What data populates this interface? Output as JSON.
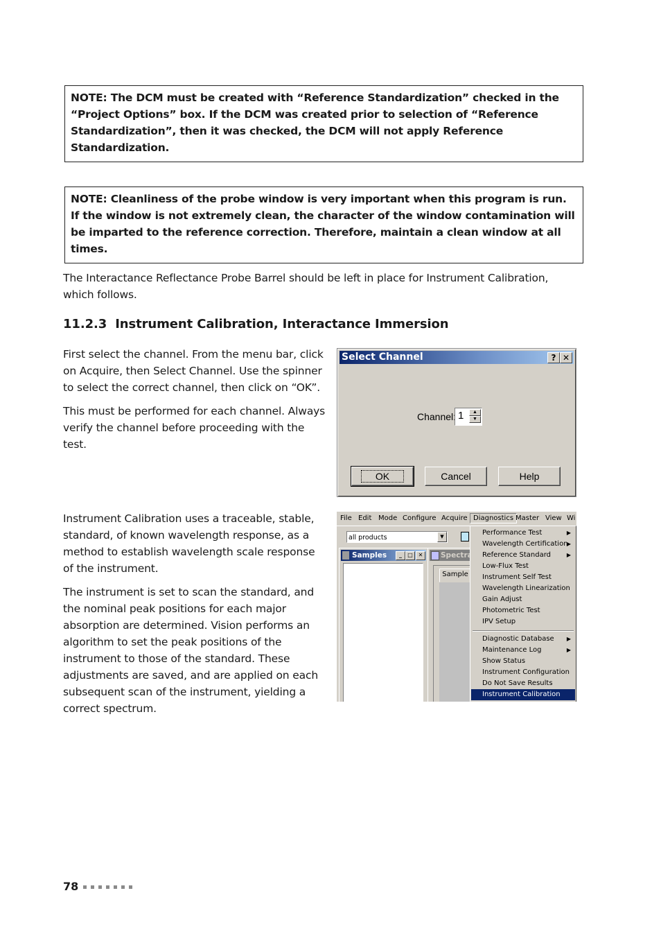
{
  "notes": [
    "NOTE: The DCM must be created with “Reference Standardization” checked in the “Project Options” box. If the DCM was created prior to selection of “Reference Standardization”, then it was checked, the DCM will not apply Reference Standardization.",
    "NOTE: Cleanliness of the probe window is very important when this program is run. If the window is not extremely clean, the character of the window contamination will be imparted to the reference correction. Therefore, maintain a clean window at all times."
  ],
  "intro_paragraph": "The Interactance Reflectance Probe Barrel should be left in place for Instrument Calibration, which follows.",
  "section": {
    "number": "11.2.3",
    "title": "Instrument Calibration, Interactance Immersion"
  },
  "body_paragraphs": {
    "select_channel_1": "First select the channel. From the menu bar, click on Acquire, then Select Channel. Use the spinner to select the correct channel, then click on “OK”.",
    "select_channel_2": "This must be performed for each channel. Always verify the channel before proceeding with the test.",
    "calibration_1": "Instrument Calibration uses a traceable, stable, standard, of known wavelength response, as a method to establish wavelength scale response of the instrument.",
    "calibration_2": "The instrument is set to scan the standard, and the nominal peak positions for each major absorption are determined. Vision performs an algorithm to set the peak positions of the instrument to those of the standard. These adjustments are saved, and are applied on each subsequent scan of the instrument, yielding a correct spectrum."
  },
  "dialog": {
    "title": "Select Channel",
    "help_title_button": "?",
    "close_title_button": "✕",
    "channel_label": "Channel:",
    "channel_value": "1",
    "ok": "OK",
    "cancel": "Cancel",
    "help": "Help"
  },
  "app": {
    "menubar": [
      "File",
      "Edit",
      "Mode",
      "Configure",
      "Acquire",
      "Diagnostics",
      "Master",
      "View",
      "Wi"
    ],
    "active_menu": "Diagnostics",
    "combo_value": "all products",
    "samples_window_title": "Samples",
    "spectra_window_title": "Spectra",
    "sample_tab": "Sample",
    "menu_items_group1": [
      {
        "label": "Performance Test",
        "submenu": true
      },
      {
        "label": "Wavelength Certification",
        "submenu": true
      },
      {
        "label": "Reference Standard",
        "submenu": true
      },
      {
        "label": "Low-Flux Test",
        "submenu": false
      },
      {
        "label": "Instrument Self Test",
        "submenu": false
      },
      {
        "label": "Wavelength Linearization",
        "submenu": false
      },
      {
        "label": "Gain Adjust",
        "submenu": false
      },
      {
        "label": "Photometric Test",
        "submenu": false
      },
      {
        "label": "IPV Setup",
        "submenu": false
      }
    ],
    "menu_items_group2": [
      {
        "label": "Diagnostic Database",
        "submenu": true
      },
      {
        "label": "Maintenance Log",
        "submenu": true
      },
      {
        "label": "Show Status",
        "submenu": false
      },
      {
        "label": "Instrument Configuration",
        "submenu": false
      },
      {
        "label": "Do Not Save Results",
        "submenu": false
      },
      {
        "label": "Instrument Calibration",
        "submenu": false,
        "selected": true
      }
    ],
    "submenu_arrow": "▶"
  },
  "footer": {
    "page_number": "78"
  },
  "colors": {
    "titlebar_start": "#0a246a",
    "titlebar_end": "#a6caf0",
    "selection": "#0a246a",
    "win_face": "#d4d0c8"
  }
}
